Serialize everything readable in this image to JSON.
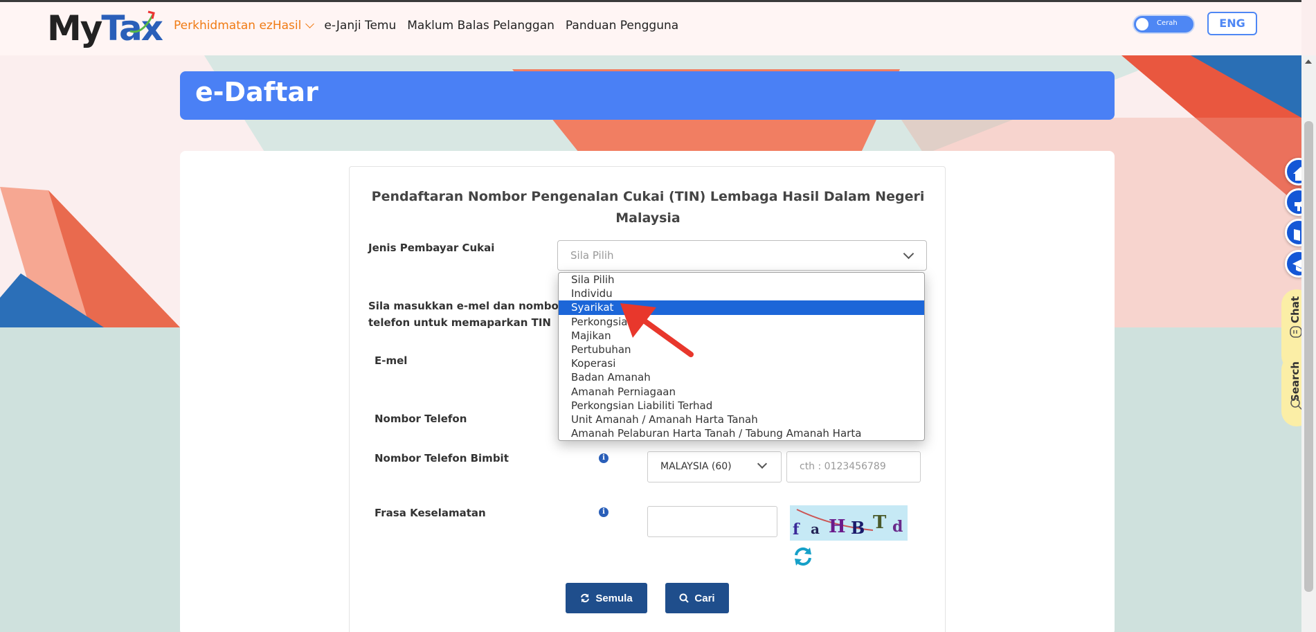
{
  "colors": {
    "accent": "#4a80f5",
    "nav_active": "#f07b14",
    "selected_option": "#1c66d8",
    "button": "#1f4e8c",
    "side_button": "#1457d6"
  },
  "header": {
    "logo_my": "My",
    "logo_tax": "Tax",
    "nav": [
      {
        "label": "Perkhidmatan ezHasil"
      },
      {
        "label": "e-Janji Temu"
      },
      {
        "label": "Maklum Balas Pelanggan"
      },
      {
        "label": "Panduan Pengguna"
      }
    ],
    "theme_toggle_label": "Cerah",
    "language_button": "ENG"
  },
  "page": {
    "title": "e-Daftar"
  },
  "form": {
    "title": "Pendaftaran Nombor Pengenalan Cukai (TIN) Lembaga Hasil Dalam Negeri Malaysia",
    "taxpayer_type_label": "Jenis Pembayar Cukai",
    "taxpayer_type_value": "Sila Pilih",
    "instruction": "Sila masukkan e-mel dan nombor telefon untuk memaparkan TIN anda.",
    "email_label": "E-mel",
    "phone_label": "Nombor Telefon",
    "mobile_label": "Nombor Telefon Bimbit",
    "country_code_value": "MALAYSIA (60)",
    "mobile_placeholder": "cth : 0123456789",
    "security_phrase_label": "Frasa Keselamatan",
    "captcha_chars": [
      "f",
      "a",
      "H",
      "B",
      "T",
      "d"
    ],
    "reset_button": "Semula",
    "search_button": "Cari"
  },
  "dropdown": {
    "selected_index": 2,
    "options": [
      "Sila Pilih",
      "Individu",
      "Syarikat",
      "Perkongsian",
      "Majikan",
      "Pertubuhan",
      "Koperasi",
      "Badan Amanah",
      "Amanah Perniagaan",
      "Perkongsian Liabiliti Terhad",
      "Unit Amanah / Amanah Harta Tanah",
      "Amanah Pelaburan Harta Tanah / Tabung Amanah Harta"
    ]
  },
  "side_tools": {
    "chat_label": "Chat",
    "search_label": "Search",
    "icons": [
      "home-icon",
      "megaphone-icon",
      "book-icon",
      "graduation-cap-icon"
    ]
  }
}
